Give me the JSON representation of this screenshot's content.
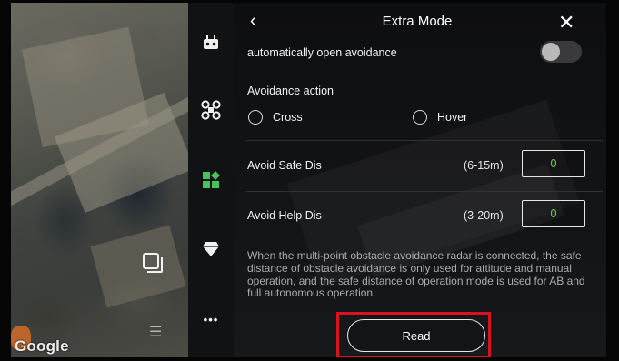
{
  "map": {
    "attribution": "Google"
  },
  "sidebar": {
    "items": [
      {
        "icon": "remote-controller-icon"
      },
      {
        "icon": "drone-icon"
      },
      {
        "icon": "apps-grid-icon",
        "active": true,
        "active_color": "#43c35a"
      },
      {
        "icon": "gem-icon"
      },
      {
        "icon": "more-icon",
        "label": "•••"
      }
    ]
  },
  "header": {
    "back": "‹",
    "title": "Extra Mode",
    "close": "✕"
  },
  "avoidance": {
    "auto_open_label": "automatically open avoidance",
    "auto_open_enabled": false,
    "action_label": "Avoidance action",
    "options": [
      "Cross",
      "Hover"
    ],
    "safe_dis": {
      "label": "Avoid Safe Dis",
      "range": "(6-15m)",
      "value": "0"
    },
    "help_dis": {
      "label": "Avoid Help Dis",
      "range": "(3-20m)",
      "value": "0"
    },
    "description": "When the multi-point obstacle avoidance radar is connected, the safe distance of obstacle avoidance is only used for attitude and manual operation, and the safe distance of operation mode is used for AB and full autonomous operation.",
    "read_label": "Read"
  },
  "colors": {
    "value_text": "#6fd14e",
    "highlight": "#d8131b"
  }
}
